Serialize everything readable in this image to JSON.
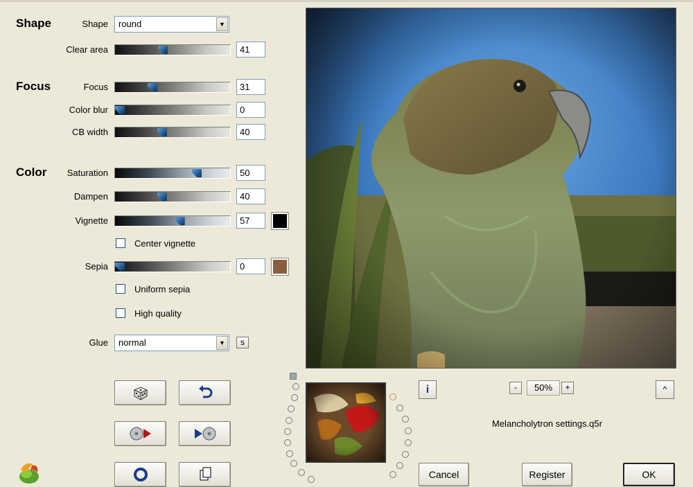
{
  "sections": {
    "shape": "Shape",
    "focus": "Focus",
    "color": "Color"
  },
  "shape": {
    "shape_label": "Shape",
    "shape_value": "round",
    "clear_area_label": "Clear area",
    "clear_area_value": "41"
  },
  "focus": {
    "focus_label": "Focus",
    "focus_value": "31",
    "color_blur_label": "Color blur",
    "color_blur_value": "0",
    "cb_width_label": "CB width",
    "cb_width_value": "40"
  },
  "color": {
    "saturation_label": "Saturation",
    "saturation_value": "50",
    "dampen_label": "Dampen",
    "dampen_value": "40",
    "vignette_label": "Vignette",
    "vignette_value": "57",
    "vignette_color": "#000000",
    "center_vignette_label": "Center vignette",
    "sepia_label": "Sepia",
    "sepia_value": "0",
    "sepia_color": "#8b5e3c",
    "uniform_sepia_label": "Uniform sepia",
    "high_quality_label": "High quality"
  },
  "glue": {
    "label": "Glue",
    "value": "normal",
    "s_button": "s"
  },
  "preview": {
    "zoom": "50%",
    "zoom_minus": "-",
    "zoom_plus": "+",
    "info": "i",
    "collapse": "^",
    "filename": "Melancholytron settings.q5r"
  },
  "buttons": {
    "cancel": "Cancel",
    "register": "Register",
    "ok": "OK"
  },
  "icons": {
    "random": "dice-icon",
    "undo": "undo-arrow-icon",
    "load": "load-settings-icon",
    "save": "save-settings-icon",
    "reset": "ring-icon",
    "copy": "copy-icon",
    "logo": "leaf-logo-icon"
  },
  "slider_levels": {
    "clear_area": 0.41,
    "focus": 0.31,
    "color_blur": 0.0,
    "cb_width": 0.4,
    "saturation": 0.73,
    "dampen": 0.4,
    "vignette": 0.57,
    "sepia": 0.0
  }
}
